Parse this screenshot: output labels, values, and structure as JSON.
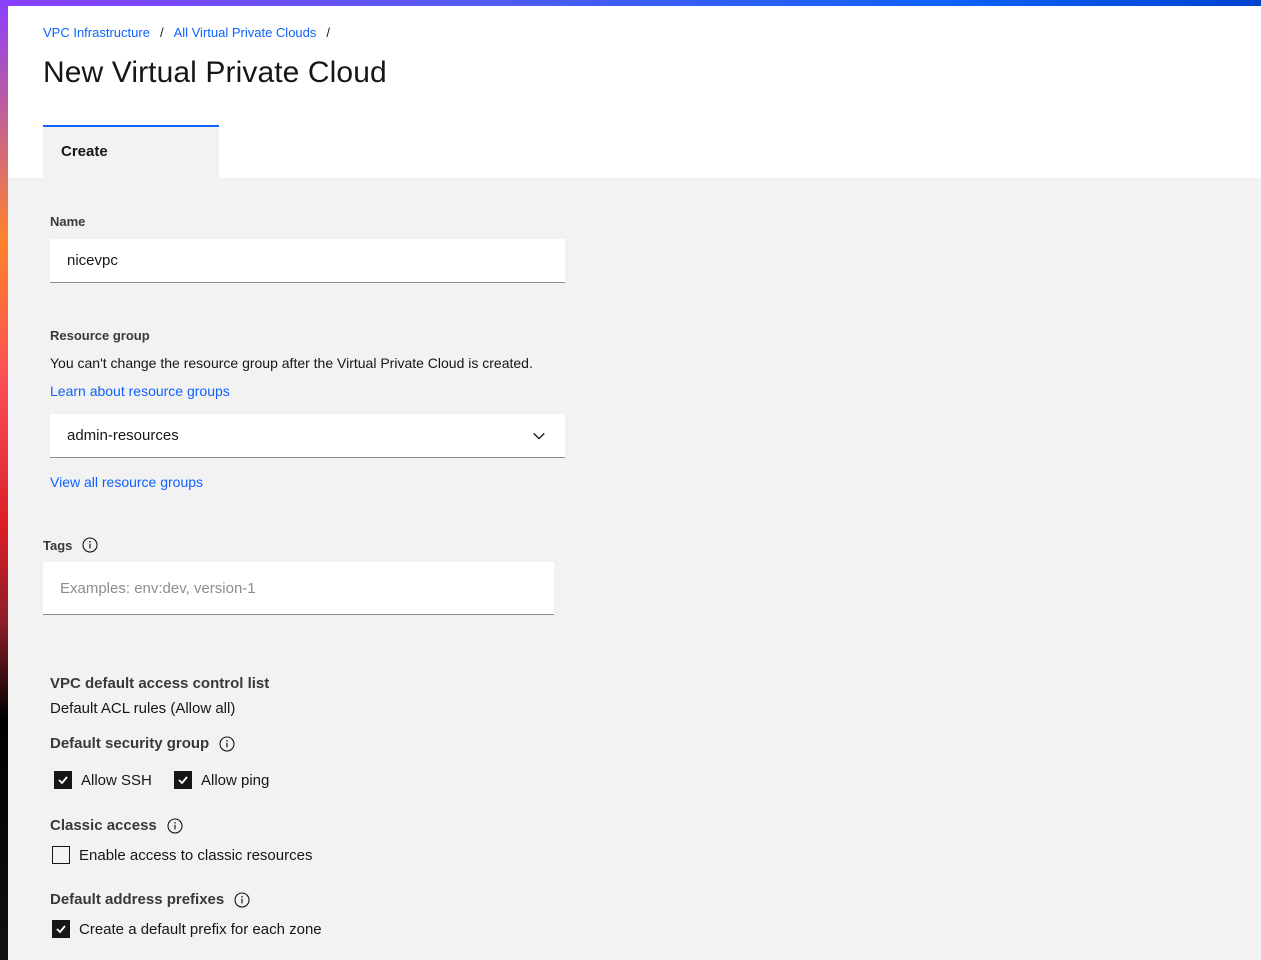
{
  "breadcrumb": [
    {
      "label": "VPC Infrastructure"
    },
    {
      "label": "All Virtual Private Clouds"
    }
  ],
  "breadcrumb_separator": "/",
  "page_title": "New Virtual Private Cloud",
  "tabs": [
    {
      "label": "Create",
      "selected": true
    }
  ],
  "form": {
    "name": {
      "label": "Name",
      "value": "nicevpc"
    },
    "resource_group": {
      "label": "Resource group",
      "helper": "You can't change the resource group after the Virtual Private Cloud is created.",
      "learn_link": "Learn about resource groups",
      "selected": "admin-resources",
      "view_all_link": "View all resource groups"
    },
    "tags": {
      "label": "Tags",
      "placeholder": "Examples: env:dev, version-1",
      "value": ""
    },
    "acl": {
      "title": "VPC default access control list",
      "value": "Default ACL rules (Allow all)"
    },
    "security_group": {
      "title": "Default security group",
      "options": [
        {
          "label": "Allow SSH",
          "checked": true
        },
        {
          "label": "Allow ping",
          "checked": true
        }
      ]
    },
    "classic_access": {
      "title": "Classic access",
      "option": {
        "label": "Enable access to classic resources",
        "checked": false
      }
    },
    "address_prefixes": {
      "title": "Default address prefixes",
      "option": {
        "label": "Create a default prefix for each zone",
        "checked": true
      }
    }
  },
  "colors": {
    "link": "#0f62fe",
    "accent": "#0f62fe",
    "background": "#f2f2f2"
  },
  "icons": [
    "chevron-down-icon",
    "info-icon",
    "checkmark-icon"
  ]
}
